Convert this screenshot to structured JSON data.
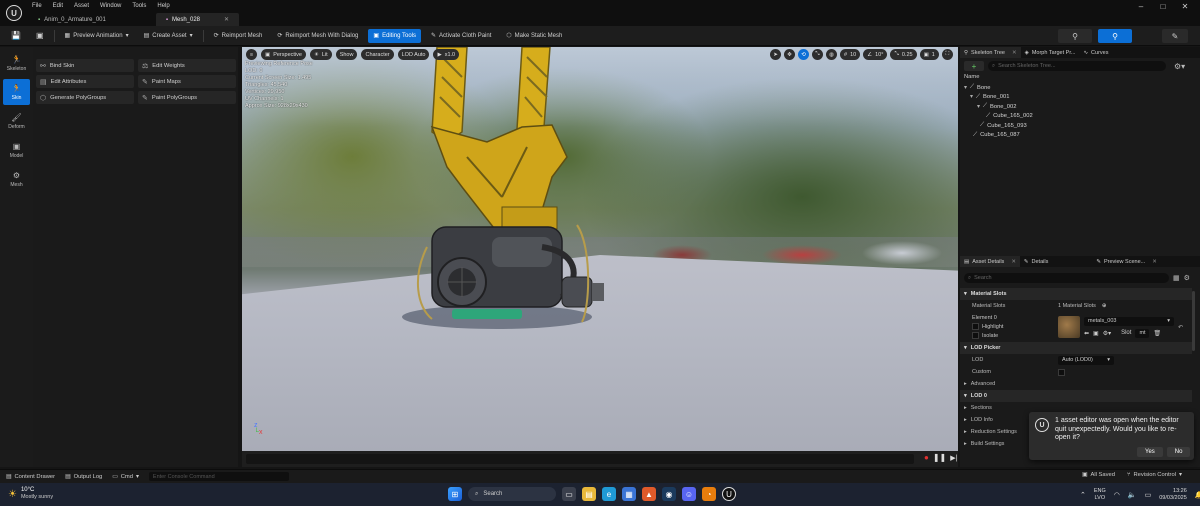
{
  "titlebar": {
    "menu": [
      "File",
      "Edit",
      "Asset",
      "Window",
      "Tools",
      "Help"
    ],
    "tabs": [
      {
        "label": "Anim_0_Armature_001",
        "active": false
      },
      {
        "label": "Mesh_028",
        "active": true
      }
    ],
    "window_controls": [
      "–",
      "□",
      "✕"
    ]
  },
  "toolbar": {
    "preview_animation": "Preview Animation",
    "create_asset": "Create Asset",
    "reimport_mesh": "Reimport Mesh",
    "reimport_with_dialog": "Reimport Mesh With Dialog",
    "editing_tools": "Editing Tools",
    "activate_cloth_paint": "Activate Cloth Paint",
    "make_static_mesh": "Make Static Mesh"
  },
  "modes": [
    {
      "label": "Skeleton",
      "icon": "running-figure-icon",
      "active": false
    },
    {
      "label": "Skin",
      "icon": "running-figure-icon",
      "active": true
    },
    {
      "label": "Deform",
      "icon": "brush-icon",
      "active": false
    },
    {
      "label": "Model",
      "icon": "cube-icon",
      "active": false
    },
    {
      "label": "Mesh",
      "icon": "mesh-icon",
      "active": false
    }
  ],
  "tools": [
    {
      "label": "Bind Skin",
      "icon": "bind-icon"
    },
    {
      "label": "Edit Weights",
      "icon": "weights-icon"
    },
    {
      "label": "Edit Attributes",
      "icon": "attributes-icon"
    },
    {
      "label": "Paint Maps",
      "icon": "paint-icon"
    },
    {
      "label": "Generate PolyGroups",
      "icon": "polygroups-icon"
    },
    {
      "label": "Paint PolyGroups",
      "icon": "paint-icon"
    }
  ],
  "viewport": {
    "perspective": "Perspective",
    "lit": "Lit",
    "show": "Show",
    "character": "Character",
    "lod": "LOD Auto",
    "play_rate": "x1.0",
    "grid_snap": "10",
    "rot_snap": "10°",
    "scale_snap": "0.25",
    "camera_speed": "1",
    "stats": [
      "Previewing Reference Pose",
      "LOD: 0",
      "Current Screen Size: 1.495",
      "Triangles: 45,540",
      "Vertices: 29,950",
      "UV Channels: 1",
      "Approx Size: 928x29x430"
    ]
  },
  "right_top": {
    "tabs": [
      "Skeleton Tree",
      "Morph Target Pr...",
      "Curves"
    ],
    "search_placeholder": "Search Skeleton Tree...",
    "column": "Name",
    "bones": [
      {
        "label": "Bone",
        "indent": 0
      },
      {
        "label": "Bone_001",
        "indent": 1
      },
      {
        "label": "Bone_002",
        "indent": 2
      },
      {
        "label": "Cube_165_002",
        "indent": 3
      },
      {
        "label": "Cube_165_093",
        "indent": 2
      },
      {
        "label": "Cube_165_087",
        "indent": 1
      }
    ]
  },
  "right_bottom": {
    "tabs": [
      "Asset Details",
      "Details",
      "Preview Scene..."
    ],
    "search_placeholder": "Search",
    "material_slots_header": "Material Slots",
    "material_slots_label": "Material Slots",
    "material_slots_value": "1 Material Slots",
    "element_label": "Element 0",
    "highlight": "Highlight",
    "isolate": "Isolate",
    "material_name": "metals_003",
    "slot_label": "Slot",
    "slot_value": "mt",
    "lod_picker_header": "LOD Picker",
    "lod_label": "LOD",
    "lod_value": "Auto (LOD0)",
    "custom_label": "Custom",
    "advanced": "Advanced",
    "lod0_header": "LOD 0",
    "sections": "Sections",
    "lod_info": "LOD Info",
    "reduction_settings": "Reduction Settings",
    "build_settings": "Build Settings"
  },
  "notification": {
    "message": "1 asset editor was open when the editor quit unexpectedly. Would you like to re-open it?",
    "yes": "Yes",
    "no": "No"
  },
  "statusbar": {
    "content_drawer": "Content Drawer",
    "output_log": "Output Log",
    "cmd": "Cmd",
    "console_placeholder": "Enter Console Command",
    "all_saved": "All Saved",
    "revision_control": "Revision Control"
  },
  "taskbar": {
    "weather_temp": "10°C",
    "weather_desc": "Mostly sunny",
    "search": "Search",
    "lang_top": "ENG",
    "lang_bottom": "LVO",
    "time": "13:26",
    "date": "09/03/2025"
  },
  "colors": {
    "accent": "#0c6fd6",
    "crane_yellow": "#d9b21f"
  }
}
